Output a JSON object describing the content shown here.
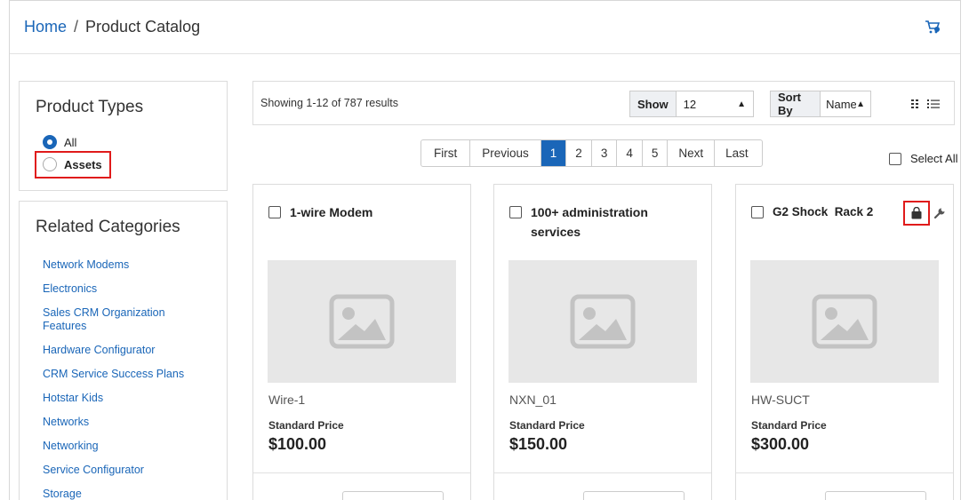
{
  "header": {
    "breadcrumb": {
      "home": "Home",
      "separator": "/",
      "current": "Product Catalog"
    },
    "cart_icon": "cart-config-icon"
  },
  "sidebar": {
    "product_types": {
      "title": "Product Types",
      "options": [
        {
          "label": "All",
          "checked": true
        },
        {
          "label": "Assets",
          "checked": false,
          "highlighted": true
        }
      ]
    },
    "related_categories": {
      "title": "Related Categories",
      "items": [
        "Network Modems",
        "Electronics",
        "Sales CRM Organization Features",
        "Hardware Configurator",
        "CRM Service Success Plans",
        "Hotstar Kids",
        "Networks",
        "Networking",
        "Service Configurator",
        "Storage"
      ]
    }
  },
  "toolbar": {
    "results_text": "Showing 1-12 of 787 results",
    "show_label": "Show",
    "show_value": "12",
    "sort_label": "Sort By",
    "sort_value": "Name",
    "grid_icon": "grid-view-icon",
    "list_icon": "list-view-icon"
  },
  "pagination": {
    "first": "First",
    "previous": "Previous",
    "pages": [
      "1",
      "2",
      "3",
      "4",
      "5"
    ],
    "active_page": "1",
    "next": "Next",
    "last": "Last"
  },
  "select_all_label": "Select All",
  "products": [
    {
      "name": "1-wire Modem",
      "sku": "Wire-1",
      "price_label": "Standard Price",
      "price": "$100.00"
    },
    {
      "name": "100+ administration services",
      "sku": "NXN_01",
      "price_label": "Standard Price",
      "price": "$150.00"
    },
    {
      "name": "G2 Shock  Rack 2",
      "sku": "HW-SUCT",
      "price_label": "Standard Price",
      "price": "$300.00",
      "tools": [
        "bag-icon",
        "wrench-icon"
      ]
    }
  ],
  "colors": {
    "link": "#1a66b8",
    "active_page": "#1a66b8",
    "highlight": "#e01b1b",
    "image_placeholder": "#e7e7e7"
  }
}
